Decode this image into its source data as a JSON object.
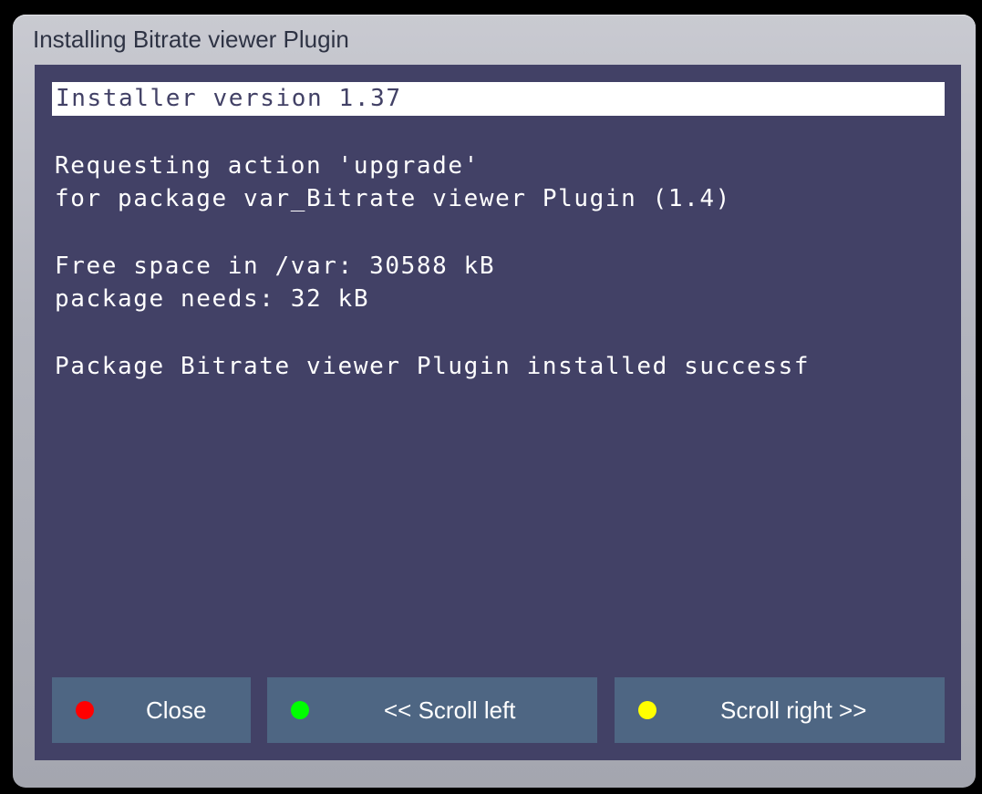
{
  "window": {
    "title": "Installing Bitrate viewer Plugin"
  },
  "installer": {
    "version_line": "Installer version 1.37"
  },
  "log": {
    "action_line_1": "Requesting action 'upgrade'",
    "action_line_2": "for package var_Bitrate viewer Plugin (1.4)",
    "space_line_1": "Free space in /var: 30588 kB",
    "space_line_2": "package needs: 32 kB",
    "result_line": "Package Bitrate viewer Plugin installed successf"
  },
  "buttons": {
    "close": {
      "label": "Close",
      "color_key": "red",
      "color": "#ff0000"
    },
    "scroll_left": {
      "label": "<< Scroll left",
      "color_key": "green",
      "color": "#00ff00"
    },
    "scroll_right": {
      "label": "Scroll right >>",
      "color_key": "yellow",
      "color": "#ffff00"
    }
  },
  "colors": {
    "panel_background": "#424166",
    "button_background": "#4e6683",
    "title_text": "#2e3344"
  }
}
